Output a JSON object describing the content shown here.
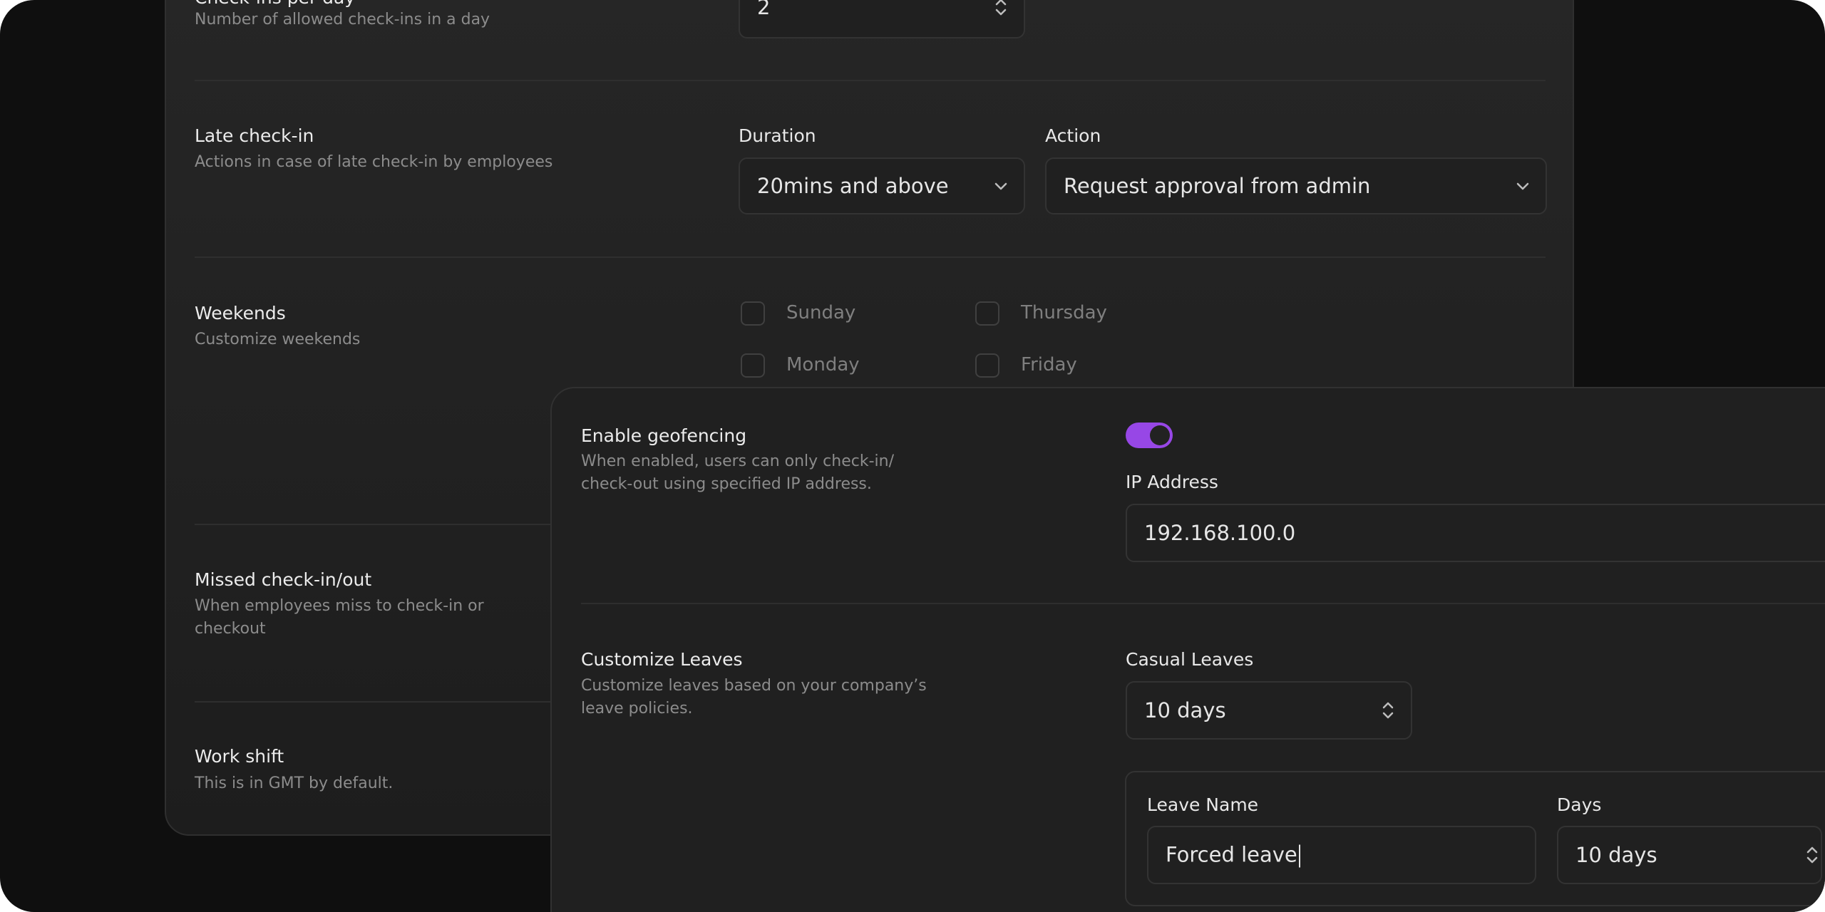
{
  "checkins": {
    "title": "Check-ins per day",
    "description": "Number of allowed check-ins in a day",
    "value": "2"
  },
  "late_checkin": {
    "title": "Late check-in",
    "description": "Actions in case of late check-in by employees",
    "duration_label": "Duration",
    "duration_value": "20mins and above",
    "action_label": "Action",
    "action_value": "Request approval from admin"
  },
  "weekends": {
    "title": "Weekends",
    "description": "Customize weekends",
    "days": [
      "Sunday",
      "Thursday",
      "Monday",
      "Friday"
    ]
  },
  "missed": {
    "title": "Missed check-in/out",
    "description_line1": "When employees miss to check-in or",
    "description_line2": "checkout"
  },
  "work_shift": {
    "title": "Work shift",
    "description": "This is in GMT by default."
  },
  "geofencing": {
    "title": "Enable geofencing",
    "description_line1": "When enabled, users can only check-in/",
    "description_line2": "check-out using specified IP address.",
    "enabled": true,
    "accent": "#9747e6",
    "ip_label": "IP Address",
    "ip_value": "192.168.100.0"
  },
  "leaves": {
    "title": "Customize Leaves",
    "description_line1": "Customize leaves based on your company’s",
    "description_line2": "leave policies.",
    "casual_label": "Casual Leaves",
    "casual_value": "10 days",
    "leave_name_label": "Leave Name",
    "leave_name_value": "Forced leave",
    "days_label": "Days",
    "days_value": "10 days"
  }
}
